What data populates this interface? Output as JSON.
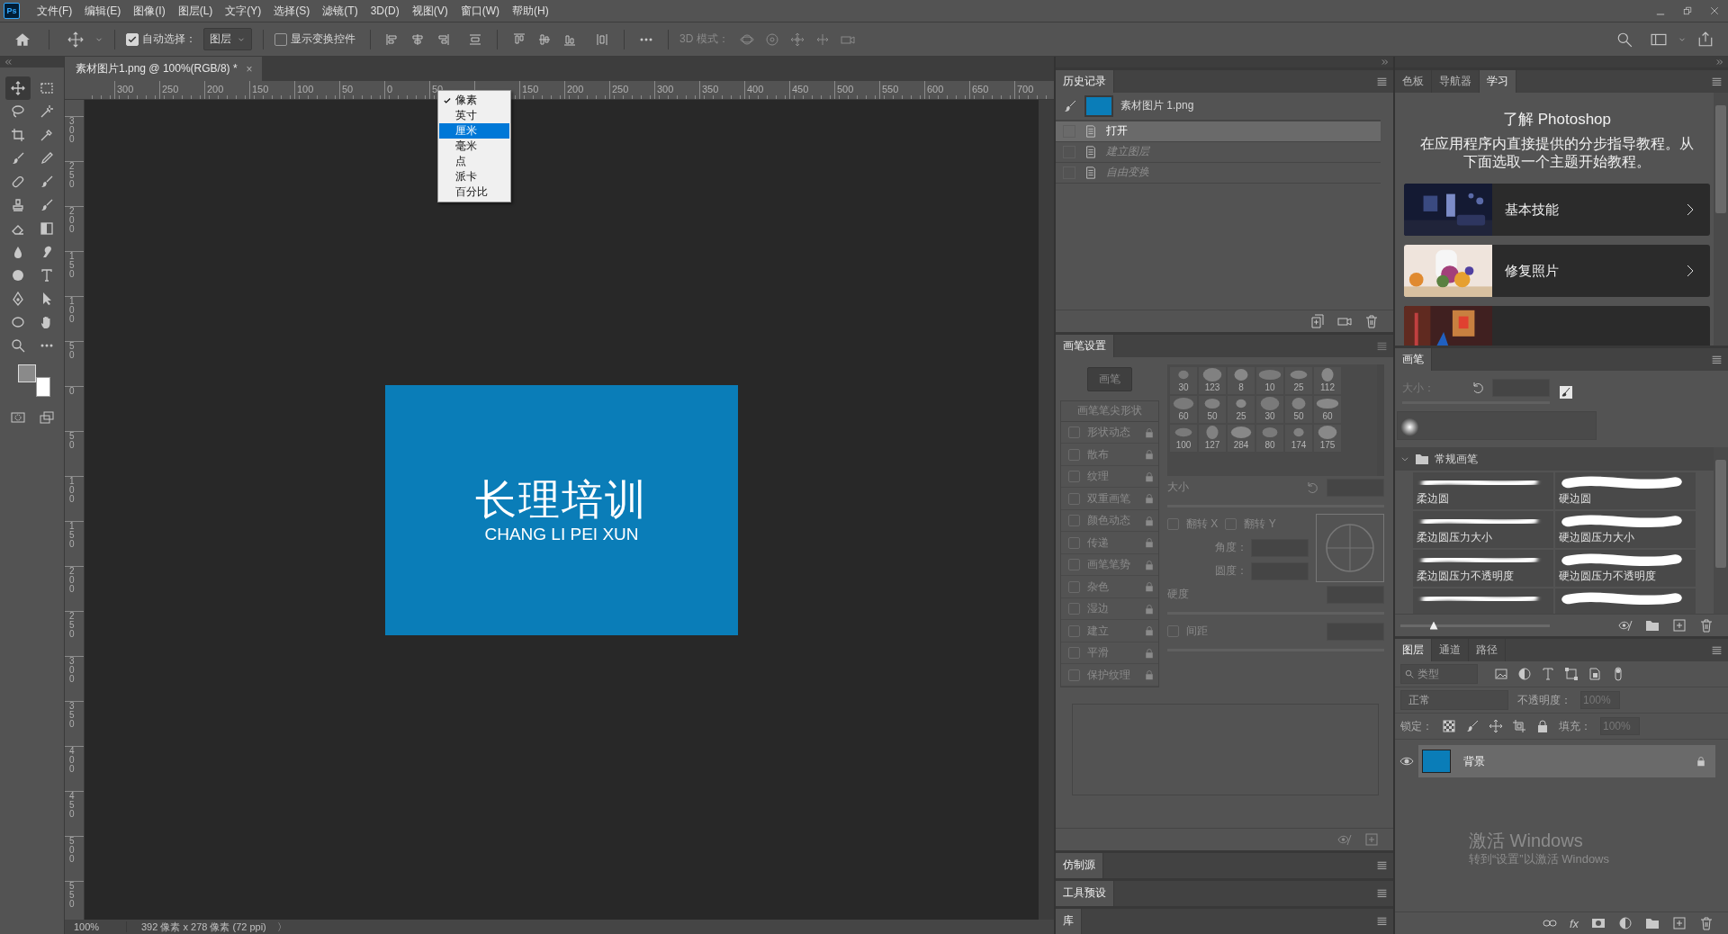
{
  "app_badge": "Ps",
  "menu": [
    "文件(F)",
    "编辑(E)",
    "图像(I)",
    "图层(L)",
    "文字(Y)",
    "选择(S)",
    "滤镜(T)",
    "3D(D)",
    "视图(V)",
    "窗口(W)",
    "帮助(H)"
  ],
  "options_bar": {
    "auto_select": {
      "label": "自动选择：",
      "checked": true
    },
    "target": "图层",
    "show_transform": {
      "label": "显示变换控件",
      "checked": false
    },
    "mode_3d": "3D 模式："
  },
  "toolbar": {
    "tools": [
      {
        "selected": true
      },
      {
        "selected": false
      },
      {
        "selected": false
      },
      {
        "selected": false
      },
      {
        "selected": false
      },
      {
        "selected": false
      },
      {
        "selected": false
      },
      {
        "selected": false
      },
      {
        "selected": false
      },
      {
        "selected": false
      },
      {
        "selected": false
      },
      {
        "selected": false
      },
      {
        "selected": false
      },
      {
        "selected": false
      },
      {
        "selected": false
      },
      {
        "selected": false
      },
      {
        "selected": false
      },
      {
        "selected": false
      },
      {
        "selected": false
      },
      {
        "selected": false
      },
      {
        "selected": false
      },
      {
        "selected": false
      },
      {
        "selected": false
      },
      {
        "selected": false
      }
    ]
  },
  "document": {
    "tab": "素材图片1.png @ 100%(RGB/8) *",
    "close": "×",
    "ruler_h": {
      "before": [
        "300",
        "250",
        "200",
        "150",
        "100",
        "50",
        "0",
        "50"
      ],
      "after": [
        "150",
        "200",
        "250",
        "300",
        "350",
        "400",
        "450",
        "500",
        "550",
        "600",
        "650",
        "700"
      ]
    },
    "ruler_v": [
      "300",
      "250",
      "200",
      "150",
      "100",
      "50",
      "0",
      "50",
      "100",
      "150",
      "200",
      "250",
      "300",
      "350",
      "400",
      "450",
      "500",
      "550"
    ],
    "image": {
      "title": "长理培训",
      "subtitle": "CHANG LI PEI XUN"
    },
    "status": {
      "zoom": "100%",
      "info": "392 像素 x 278 像素 (72 ppi)",
      "more": "〉"
    }
  },
  "unit_menu": {
    "items": [
      {
        "label": "像素",
        "checked": true,
        "selected": false
      },
      {
        "label": "英寸",
        "checked": false,
        "selected": false
      },
      {
        "label": "厘米",
        "checked": false,
        "selected": true
      },
      {
        "label": "毫米",
        "checked": false,
        "selected": false
      },
      {
        "label": "点",
        "checked": false,
        "selected": false
      },
      {
        "label": "派卡",
        "checked": false,
        "selected": false
      },
      {
        "label": "百分比",
        "checked": false,
        "selected": false
      }
    ]
  },
  "history": {
    "tab": "历史记录",
    "snapshot": "素材图片 1.png",
    "steps": [
      {
        "label": "打开",
        "selected": true,
        "dimmed": false
      },
      {
        "label": "建立图层",
        "selected": false,
        "dimmed": true
      },
      {
        "label": "自由变换",
        "selected": false,
        "dimmed": true
      }
    ]
  },
  "brush_settings": {
    "tab": "画笔设置",
    "disabled": true,
    "brush_button": "画笔",
    "tip_shape": "画笔笔尖形状",
    "options": [
      {
        "label": "形状动态",
        "checked": false
      },
      {
        "label": "散布",
        "checked": false
      },
      {
        "label": "纹理",
        "checked": false
      },
      {
        "label": "双重画笔",
        "checked": false
      },
      {
        "label": "颜色动态",
        "checked": false
      },
      {
        "label": "传递",
        "checked": false
      },
      {
        "label": "画笔笔势",
        "checked": false
      },
      {
        "label": "杂色",
        "checked": false
      },
      {
        "label": "湿边",
        "checked": false
      },
      {
        "label": "建立",
        "checked": false
      },
      {
        "label": "平滑",
        "checked": false
      },
      {
        "label": "保护纹理",
        "checked": false
      }
    ],
    "tips": [
      "30",
      "123",
      "8",
      "10",
      "25",
      "112",
      "60",
      "50",
      "25",
      "30",
      "50",
      "60",
      "100",
      "127",
      "284",
      "80",
      "174",
      "175"
    ],
    "size_label": "大小",
    "flip_x": {
      "label": "翻转 X",
      "checked": false
    },
    "flip_y": {
      "label": "翻转 Y",
      "checked": false
    },
    "angle_label": "角度：",
    "roundness_label": "圆度：",
    "hardness_label": "硬度",
    "spacing": {
      "label": "间距",
      "checked": false
    }
  },
  "collapsed_panels": [
    "仿制源",
    "工具预设",
    "库"
  ],
  "learn": {
    "tabs": [
      {
        "label": "色板",
        "selected": false
      },
      {
        "label": "导航器",
        "selected": false
      },
      {
        "label": "学习",
        "selected": true
      }
    ],
    "title": "了解 Photoshop",
    "text": "在应用程序内直接提供的分步指导教程。从下面选取一个主题开始教程。",
    "cards": [
      {
        "kind": "full",
        "title": "基本技能"
      },
      {
        "kind": "full",
        "title": "修复照片"
      },
      {
        "kind": "partial"
      }
    ]
  },
  "brushes": {
    "tab": "画笔",
    "size_label": "大小：",
    "group": {
      "name": "常规画笔",
      "expanded": true
    },
    "presets": [
      {
        "kind": "soft",
        "name": "柔边圆"
      },
      {
        "kind": "hard",
        "name": "硬边圆"
      },
      {
        "kind": "soft",
        "name": "柔边圆压力大小"
      },
      {
        "kind": "hard",
        "name": "硬边圆压力大小"
      },
      {
        "kind": "soft",
        "name": "柔边圆压力不透明度"
      },
      {
        "kind": "hard",
        "name": "硬边圆压力不透明度"
      },
      {
        "kind": "soft"
      },
      {
        "kind": "hard"
      }
    ],
    "slider": {
      "level": 0.22
    }
  },
  "layers": {
    "tabs": [
      {
        "label": "图层",
        "selected": true
      },
      {
        "label": "通道",
        "selected": false
      },
      {
        "label": "路径",
        "selected": false
      }
    ],
    "filter": "类型",
    "blend": "正常",
    "opacity_label": "不透明度：",
    "opacity": "100%",
    "lock_label": "锁定：",
    "fill_label": "填充：",
    "fill": "100%",
    "fx": "fx",
    "items": [
      {
        "name": "背景",
        "visible": true,
        "locked": true,
        "selected": true
      }
    ]
  },
  "system_notice": {
    "title": "激活 Windows",
    "text": "转到“设置”以激活 Windows"
  }
}
